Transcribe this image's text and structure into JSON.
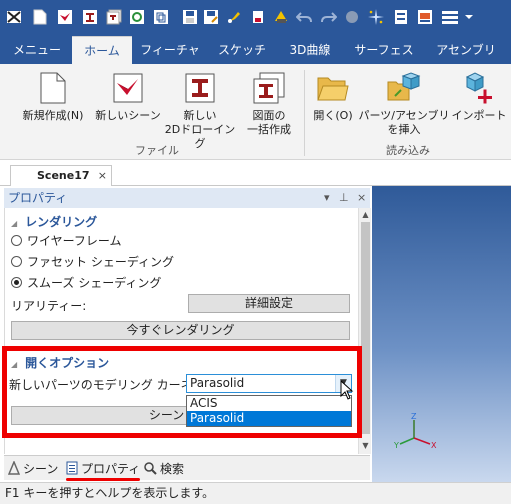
{
  "quick_access": {
    "items": [
      "app-logo-icon",
      "new-file-icon",
      "new-scene-icon",
      "new-drawing-icon",
      "drawing-batch-icon",
      "web-icon",
      "copy-icon",
      "save-icon",
      "save-as-icon",
      "pin-icon",
      "cart-icon",
      "undo-icon",
      "redo-icon",
      "sphere-icon",
      "sparkle-icon",
      "layout-icon",
      "orange-window-icon",
      "list-icon",
      "dropdown-arrow-icon"
    ]
  },
  "ribbon_tabs": {
    "items": [
      "メニュー",
      "ホーム",
      "フィーチャ",
      "スケッチ",
      "3D曲線",
      "サーフェス",
      "アセンブリ"
    ],
    "active": "ホーム"
  },
  "ribbon": {
    "file_group": {
      "label": "ファイル",
      "new_file": {
        "label": "新規作成(N)",
        "icon": "blank-page-icon"
      },
      "new_scene": {
        "label": "新しいシーン",
        "icon": "scene-bird-icon"
      },
      "new_2d_drawing": {
        "line1": "新しい",
        "line2": "2Dドローイング",
        "icon": "drawing-2d-icon"
      },
      "batch_drawing": {
        "line1": "図面の",
        "line2": "一括作成",
        "icon": "batch-drawing-icon"
      }
    },
    "load_group": {
      "label": "読み込み",
      "open": {
        "label": "開く(O)",
        "icon": "open-folder-icon"
      },
      "insert_part": {
        "line1": "パーツ/アセンブリ",
        "line2": "を挿入",
        "icon": "insert-part-icon"
      },
      "import": {
        "label": "インポート",
        "icon": "import-icon"
      }
    }
  },
  "doc_tab": {
    "label": "Scene17",
    "close": "×"
  },
  "pane": {
    "title": "プロパティ",
    "menu_glyph": "▾",
    "pin_glyph": "⊥",
    "close_glyph": "×",
    "rendering": {
      "heading": "レンダリング",
      "options": [
        "ワイヤーフレーム",
        "ファセット シェーディング",
        "スムーズ シェーディング"
      ],
      "selected_index": 2,
      "fidelity_label": "リアリティー:",
      "detail_button": "詳細設定",
      "render_now_button": "今すぐレンダリング"
    },
    "open_options": {
      "heading": "開くオプション",
      "kernel_label": "新しいパーツのモデリング カーネル:",
      "kernel_value": "Parasolid",
      "kernel_options": [
        "ACIS",
        "Parasolid"
      ],
      "kernel_selected": "Parasolid",
      "scene_button_partial": "シーン プロ"
    }
  },
  "pane_tabs": {
    "items": [
      {
        "label": "シーン",
        "icon": "scene-tree-icon"
      },
      {
        "label": "プロパティ",
        "icon": "properties-icon"
      },
      {
        "label": "検索",
        "icon": "search-icon"
      }
    ],
    "active": "プロパティ"
  },
  "viewport": {
    "axes": {
      "x": "X",
      "y": "Y",
      "z": "Z"
    }
  },
  "status_bar": {
    "text": "F1 キーを押すとヘルプを表示します。"
  },
  "colors": {
    "ribbon_blue": "#2b579a",
    "highlight_red": "#ee0000",
    "selection_blue": "#0078d7"
  }
}
